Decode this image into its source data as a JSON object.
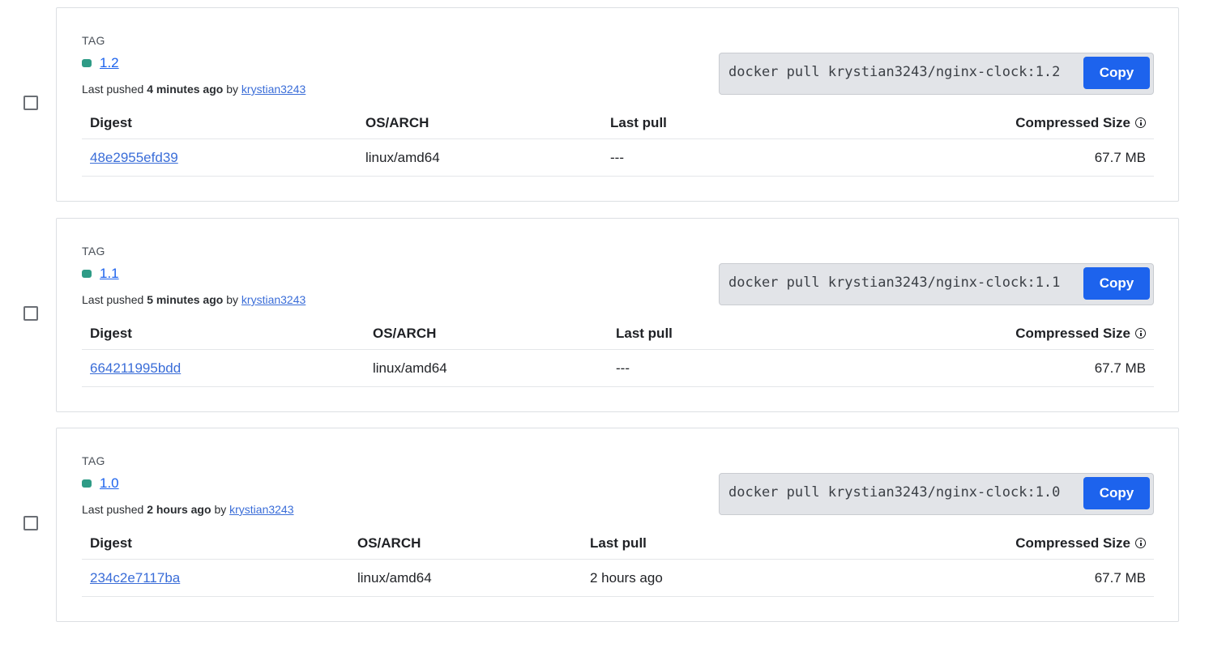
{
  "tags": [
    {
      "tag_label": "TAG",
      "name": "1.2",
      "pushed_prefix": "Last pushed",
      "pushed_time": "4 minutes ago",
      "pushed_by_word": "by",
      "pushed_user": "krystian3243",
      "pull_command": "docker pull krystian3243/nginx-clock:1.2",
      "copy_label": "Copy",
      "headers": {
        "digest": "Digest",
        "os_arch": "OS/ARCH",
        "last_pull": "Last pull",
        "size": "Compressed Size"
      },
      "digest": "48e2955efd39",
      "os_arch": "linux/amd64",
      "last_pull": "---",
      "size": "67.7 MB"
    },
    {
      "tag_label": "TAG",
      "name": "1.1",
      "pushed_prefix": "Last pushed",
      "pushed_time": "5 minutes ago",
      "pushed_by_word": "by",
      "pushed_user": "krystian3243",
      "pull_command": "docker pull krystian3243/nginx-clock:1.1",
      "copy_label": "Copy",
      "headers": {
        "digest": "Digest",
        "os_arch": "OS/ARCH",
        "last_pull": "Last pull",
        "size": "Compressed Size"
      },
      "digest": "664211995bdd",
      "os_arch": "linux/amd64",
      "last_pull": "---",
      "size": "67.7 MB"
    },
    {
      "tag_label": "TAG",
      "name": "1.0",
      "pushed_prefix": "Last pushed",
      "pushed_time": "2 hours ago",
      "pushed_by_word": "by",
      "pushed_user": "krystian3243",
      "pull_command": "docker pull krystian3243/nginx-clock:1.0",
      "copy_label": "Copy",
      "headers": {
        "digest": "Digest",
        "os_arch": "OS/ARCH",
        "last_pull": "Last pull",
        "size": "Compressed Size"
      },
      "digest": "234c2e7117ba",
      "os_arch": "linux/amd64",
      "last_pull": "2 hours ago",
      "size": "67.7 MB"
    }
  ],
  "colors": {
    "accent": "#1d63ed",
    "tag_dot": "#2e9b86",
    "border": "#dcdfe3"
  },
  "icons": {
    "info": "info-icon",
    "status": "tag-status-dot"
  }
}
